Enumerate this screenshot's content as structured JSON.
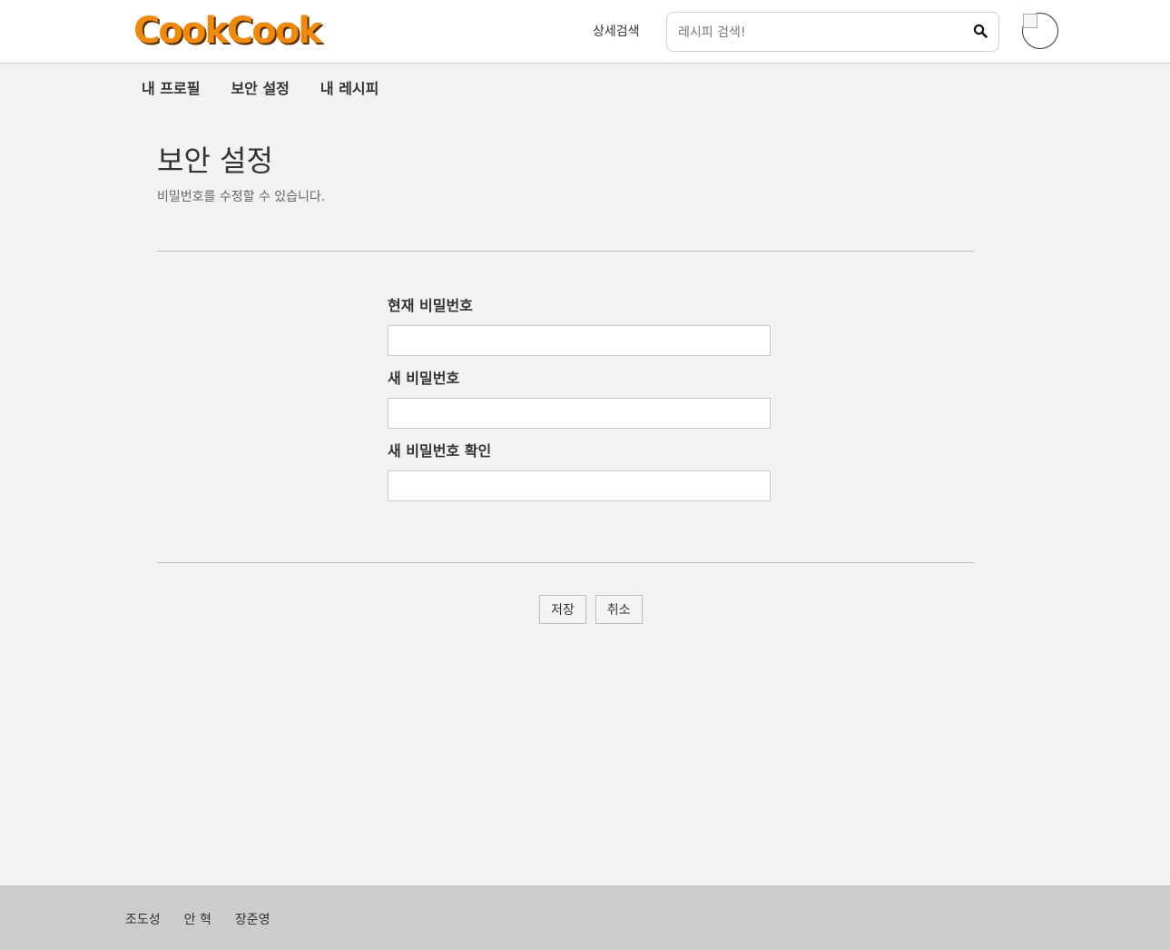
{
  "header": {
    "logo_text": "CookCook",
    "advanced_search_label": "상세검색",
    "search_placeholder": "레시피 검색!",
    "search_icon": "search-icon",
    "avatar_icon": "broken-image-icon"
  },
  "subnav": {
    "items": [
      {
        "label": "내 프로필"
      },
      {
        "label": "보안 설정"
      },
      {
        "label": "내 레시피"
      }
    ]
  },
  "main": {
    "title": "보안 설정",
    "description": "비밀번호를 수정할 수 있습니다.",
    "fields": [
      {
        "label": "현재 비밀번호",
        "value": ""
      },
      {
        "label": "새 비밀번호",
        "value": ""
      },
      {
        "label": "새 비밀번호 확인",
        "value": ""
      }
    ],
    "save_label": "저장",
    "cancel_label": "취소"
  },
  "footer": {
    "names": [
      "조도성",
      "안 혁",
      "장준영"
    ]
  },
  "colors": {
    "brand_orange": "#f08a0c",
    "page_background": "#f2f2f2",
    "footer_background": "#cccccc"
  }
}
